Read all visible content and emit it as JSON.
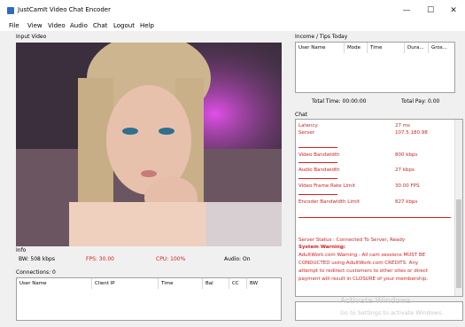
{
  "window": {
    "title": "JustCamIt Video Chat Encoder",
    "controls": {
      "minimize": "—",
      "maximize": "☐",
      "close": "✕"
    }
  },
  "menu": [
    "File",
    "View",
    "Video",
    "Audio",
    "Chat",
    "Logout",
    "Help"
  ],
  "input_video": {
    "label": "Input Video"
  },
  "info": {
    "label": "Info",
    "bandwidth": "BW: 508 kbps",
    "fps": "FPS: 30.00",
    "cpu": "CPU: 100%",
    "audio": "Audio: On"
  },
  "connections": {
    "label": "Connections: 0",
    "columns": [
      "User Name",
      "Client IP",
      "Time",
      "Bal",
      "CC",
      "BW"
    ]
  },
  "income": {
    "label": "Income / Tips Today",
    "columns": [
      "User Name",
      "Mode",
      "Time",
      "Dura...",
      "Gros..."
    ],
    "total_time": "Total Time: 00:00:00",
    "total_pay": "Total Pay: 0.00"
  },
  "chat": {
    "label": "Chat",
    "stats": [
      {
        "name": "Latency",
        "value": "27 ms"
      },
      {
        "name": "Server",
        "value": "107.5.180.98"
      },
      {
        "name": "Video Bandwidth",
        "value": "800 kbps"
      },
      {
        "name": "Audio Bandwidth",
        "value": "27 kbps"
      },
      {
        "name": "Video Frame Rate Limit",
        "value": "30.00 FPS"
      },
      {
        "name": "Encoder Bandwidth Limit",
        "value": "827 kbps"
      }
    ],
    "status": "Server Status : Connected To Server, Ready",
    "warning_title": "System Warning:",
    "warning_lines": [
      "AdultWork.com Warning : All cam sessions MUST BE",
      "CONDUCTED using AdultWork.com CREDITS. Any",
      "attempt to redirect customers to other sites or direct",
      "payment will result in CLOSURE of your membership."
    ]
  },
  "watermark": {
    "line1": "Activate Windows",
    "line2": "Go to Settings to activate Windows."
  },
  "colors": {
    "accent_red": "#d32020",
    "video_bg": "#3a2e3a"
  }
}
